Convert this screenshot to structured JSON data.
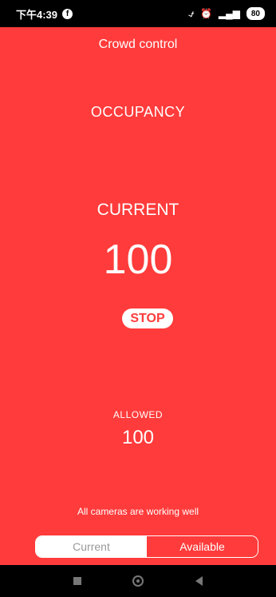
{
  "status_bar": {
    "time": "下午4:39",
    "battery": "80",
    "icons": [
      "facebook-icon",
      "mute-icon",
      "alarm-icon",
      "signal-icon",
      "battery-icon"
    ]
  },
  "app": {
    "title": "Crowd control"
  },
  "occupancy": {
    "heading": "OCCUPANCY",
    "current_label": "CURRENT",
    "current_value": "100",
    "stop_label": "STOP",
    "allowed_label": "ALLOWED",
    "allowed_value": "100"
  },
  "camera": {
    "status_text": "All cameras are working well"
  },
  "toggle": {
    "current_label": "Current",
    "available_label": "Available",
    "selected": "Available"
  },
  "colors": {
    "background": "#ff3b3b",
    "text": "#ffffff"
  },
  "nav_bar": {
    "icons": [
      "recent-apps-icon",
      "home-icon",
      "back-icon"
    ]
  }
}
